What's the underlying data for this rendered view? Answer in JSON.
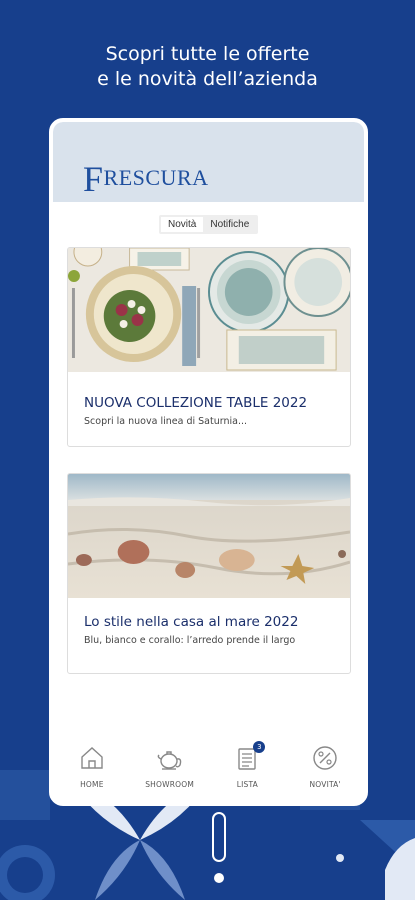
{
  "headline": {
    "line1": "Scopri tutte le offerte",
    "line2": "e le novità dell’azienda"
  },
  "brand": {
    "initial": "F",
    "rest": "RESCURA"
  },
  "tabs": [
    {
      "label": "Novità",
      "active": true
    },
    {
      "label": "Notifiche",
      "active": false
    }
  ],
  "cards": [
    {
      "title": "NUOVA COLLEZIONE TABLE 2022",
      "subtitle": "Scopri la nuova linea di Saturnia..."
    },
    {
      "title": "Lo stile nella casa al mare 2022",
      "subtitle": "Blu, bianco e corallo: l’arredo prende il largo"
    }
  ],
  "nav": [
    {
      "label": "HOME",
      "icon": "home-icon"
    },
    {
      "label": "SHOWROOM",
      "icon": "teapot-icon"
    },
    {
      "label": "LISTA",
      "icon": "list-icon",
      "badge": "3"
    },
    {
      "label": "NOVITA'",
      "icon": "percent-icon"
    }
  ],
  "colors": {
    "background": "#173f8c",
    "accent": "#1b2f6b",
    "header": "#d9e2ec"
  }
}
